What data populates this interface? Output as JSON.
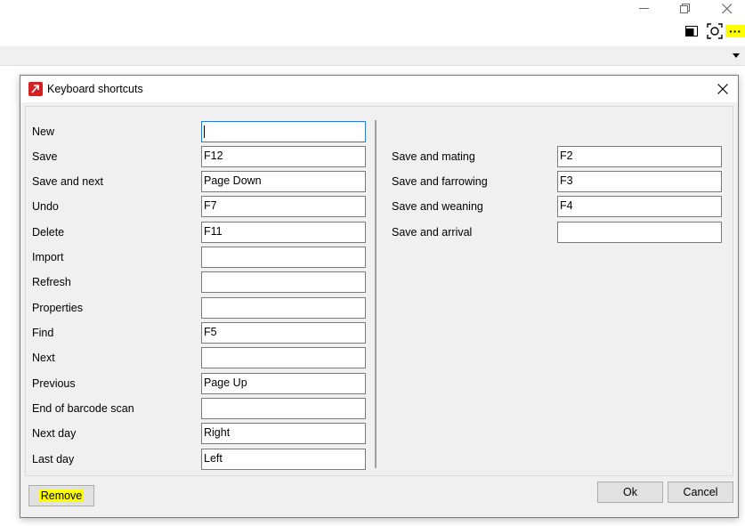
{
  "window_controls": {
    "minimize": "minimize",
    "restore": "restore",
    "close": "close"
  },
  "toolbar": {
    "icons": [
      "panel-icon",
      "screenshot-icon",
      "more-icon"
    ],
    "more_label": "···",
    "more_highlight": "#ffff00"
  },
  "dialog": {
    "title": "Keyboard shortcuts",
    "app_icon_color": "#d42020",
    "left_rows": [
      {
        "label": "New",
        "value": ""
      },
      {
        "label": "Save",
        "value": "F12"
      },
      {
        "label": "Save and next",
        "value": "Page Down"
      },
      {
        "label": "Undo",
        "value": "F7"
      },
      {
        "label": "Delete",
        "value": "F11"
      },
      {
        "label": "Import",
        "value": ""
      },
      {
        "label": "Refresh",
        "value": ""
      },
      {
        "label": "Properties",
        "value": ""
      },
      {
        "label": "Find",
        "value": "F5"
      },
      {
        "label": "Next",
        "value": ""
      },
      {
        "label": "Previous",
        "value": "Page Up"
      },
      {
        "label": "End of barcode scan",
        "value": ""
      },
      {
        "label": "Next day",
        "value": "Right"
      },
      {
        "label": "Last day",
        "value": "Left"
      }
    ],
    "right_rows": [
      {
        "label": "Save and mating",
        "value": "F2"
      },
      {
        "label": "Save and farrowing",
        "value": "F3"
      },
      {
        "label": "Save and weaning",
        "value": "F4"
      },
      {
        "label": "Save and arrival",
        "value": ""
      }
    ],
    "buttons": {
      "remove": "Remove",
      "ok": "Ok",
      "cancel": "Cancel"
    },
    "highlight_color": "#ffff00"
  }
}
